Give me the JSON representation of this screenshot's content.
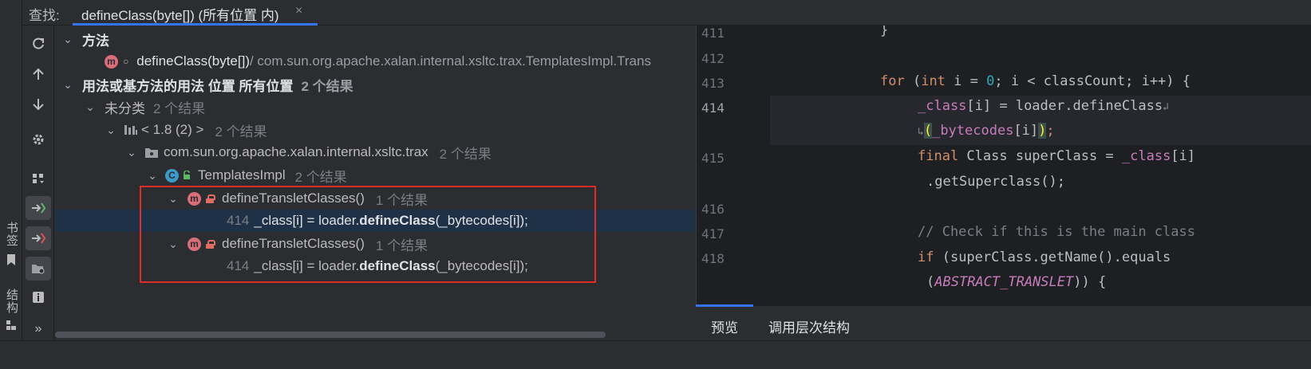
{
  "tabbar": {
    "find_label": "查找:",
    "tab_title": "defineClass(byte[]) (所有位置 内)",
    "close": "×"
  },
  "left_stripe": {
    "bookmarks": "书签",
    "structure": "结构"
  },
  "toolbar": {
    "more": "»"
  },
  "tree": {
    "methods_header": "方法",
    "method_name": "defineClass(byte[])",
    "method_path": " / com.sun.org.apache.xalan.internal.xsltc.trax.TemplatesImpl.Trans",
    "usages_header": "用法或基方法的用法 位置 所有位置",
    "usages_count": "2 个结果",
    "unclassified": "未分类",
    "unclassified_count": "2 个结果",
    "jdk": "< 1.8 (2) >",
    "jdk_count": "2 个结果",
    "package": "com.sun.org.apache.xalan.internal.xsltc.trax",
    "package_count": "2 个结果",
    "class": "TemplatesImpl",
    "class_count": "2 个结果",
    "results": [
      {
        "method": "defineTransletClasses()",
        "count": "1 个结果",
        "line": "414",
        "pre": "_class[i] = loader.",
        "match": "defineClass",
        "post": "(_bytecodes[i]);"
      },
      {
        "method": "defineTransletClasses()",
        "count": "1 个结果",
        "line": "414",
        "pre": "_class[i] = loader.",
        "match": "defineClass",
        "post": "(_bytecodes[i]);"
      }
    ]
  },
  "code": {
    "line_numbers": [
      "411",
      "412",
      "413",
      "414",
      "415",
      "416",
      "417",
      "418"
    ],
    "brace": "}",
    "for_kw": "for",
    "for_open": " (",
    "int_kw": "int",
    "for_mid1": " i = ",
    "zero": "0",
    "for_rest": "; i < classCount; i++) {",
    "l414_field": "_class",
    "l414_rest": "[i] = loader.defineClass",
    "l414b_field": "_bytecodes",
    "l414b_rest": "[i]",
    "final_kw": "final",
    "l415_mid": " Class superClass = ",
    "l415_field": "_class",
    "l415_end": "[i]",
    "l415b": ".getSuperclass();",
    "comment": "// Check if this is the main class",
    "if_kw": "if",
    "l418_rest": " (superClass.getName().equals",
    "l418b_open": "(",
    "const": "ABSTRACT_TRANSLET",
    "l418b_close": ")) {"
  },
  "preview_tabs": {
    "preview": "预览",
    "call_hierarchy": "调用层次结构"
  },
  "colors": {
    "accent": "#3574f0",
    "highlight_box": "#e02b2b",
    "selected_row": "#1f3147"
  }
}
